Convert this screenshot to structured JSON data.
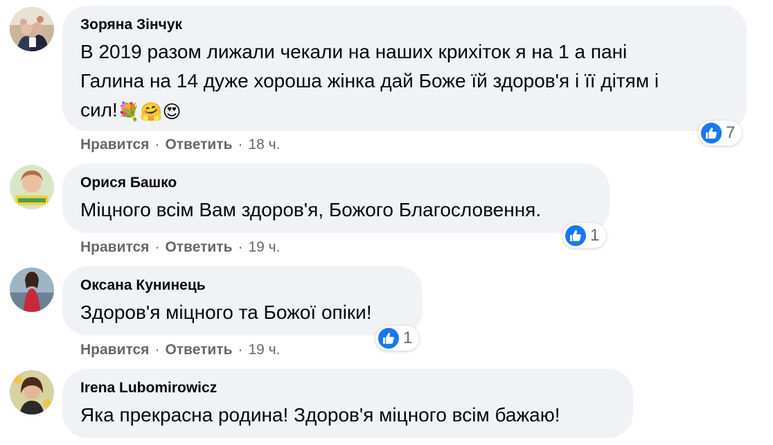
{
  "colors": {
    "bubble_bg": "#f0f2f5",
    "like_blue": "#1877f2",
    "secondary_text": "#65676b"
  },
  "actions": {
    "like_label": "Нравится",
    "reply_label": "Ответить",
    "separator": "·"
  },
  "comments": [
    {
      "author": "Зоряна Зінчук",
      "text_lines": [
        "В 2019 разом лижали чекали на наших крихіток я на 1 а пані",
        "Галина на 14 дуже хороша жінка дай Боже їй здоров'я і її дітям і",
        "сил!"
      ],
      "emojis": [
        "💐",
        "🤗",
        "😍"
      ],
      "reaction_icon": "thumbs-up-icon",
      "reaction_count": "7",
      "time": "18 ч."
    },
    {
      "author": "Орися Башко",
      "text": "Міцного всім Вам здоров'я, Божого Благословення.",
      "reaction_icon": "thumbs-up-icon",
      "reaction_count": "1",
      "time": "19 ч."
    },
    {
      "author": "Оксана Кунинець",
      "text": "Здоров'я міцного та Божої опіки!",
      "reaction_icon": "thumbs-up-icon",
      "reaction_count": "1",
      "time": "19 ч."
    },
    {
      "author": "Irena Lubomirowicz",
      "text": "Яка прекрасна родина! Здоров'я міцного всім бажаю!"
    }
  ]
}
